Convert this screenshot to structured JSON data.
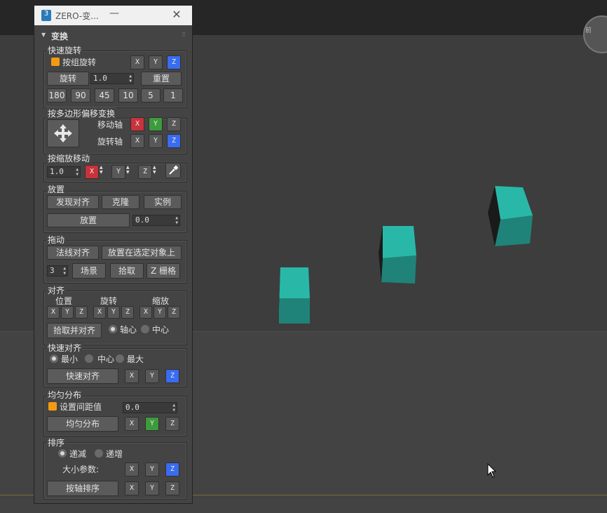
{
  "panel": {
    "title": "ZERO-变...",
    "app_icon": "3",
    "rollout_title": "变换"
  },
  "viewport": {
    "nav_label": "前"
  },
  "quick_rotate": {
    "label": "快速旋转",
    "group_rotate": "按组旋转",
    "axes": [
      "X",
      "Y",
      "Z"
    ],
    "active_axis": "Z",
    "rotate_btn": "旋转",
    "rotate_value": "1.0",
    "reset_btn": "重置",
    "angles": [
      "180",
      "90",
      "45",
      "10",
      "5",
      "1"
    ]
  },
  "poly_offset": {
    "label": "按多边形偏移变换",
    "move_axis_label": "移动轴",
    "rotate_axis_label": "旋转轴",
    "move_axes": [
      "X",
      "Y",
      "Z"
    ],
    "rotate_axes": [
      "X",
      "Y",
      "Z"
    ]
  },
  "scale_move": {
    "label": "按缩放移动",
    "value": "1.0",
    "axes": [
      "X",
      "Y",
      "Z"
    ]
  },
  "place": {
    "label": "放置",
    "find_align": "发现对齐",
    "clone": "克隆",
    "instance": "实例",
    "place_btn": "放置",
    "value": "0.0"
  },
  "drag": {
    "label": "拖动",
    "normal_align": "法线对齐",
    "place_on_selected": "放置在选定对象上",
    "count": "3",
    "scene": "场景",
    "pick": "拾取",
    "z_grid": "Z 栅格"
  },
  "align": {
    "label": "对齐",
    "position": "位置",
    "rotation": "旋转",
    "scale": "缩放",
    "axes": [
      "X",
      "Y",
      "Z"
    ],
    "pick_align": "拾取并对齐",
    "pivot": "轴心",
    "center": "中心"
  },
  "quick_align": {
    "label": "快速对齐",
    "min": "最小",
    "center": "中心",
    "max": "最大",
    "btn": "快速对齐",
    "axes": [
      "X",
      "Y",
      "Z"
    ]
  },
  "distribute": {
    "label": "均匀分布",
    "set_spacing": "设置间距值",
    "value": "0.0",
    "btn": "均匀分布",
    "axes": [
      "X",
      "Y",
      "Z"
    ]
  },
  "sort": {
    "label": "排序",
    "desc": "递减",
    "asc": "递增",
    "size_param": "大小参数:",
    "btn": "按轴排序",
    "axes": [
      "X",
      "Y",
      "Z"
    ]
  },
  "colors": {
    "accent_blue": "#3a6cf0",
    "accent_red": "#c8333b",
    "accent_green": "#3d9a3d",
    "checkbox_orange": "#f39a14",
    "cube_teal": "#29b8a8"
  }
}
